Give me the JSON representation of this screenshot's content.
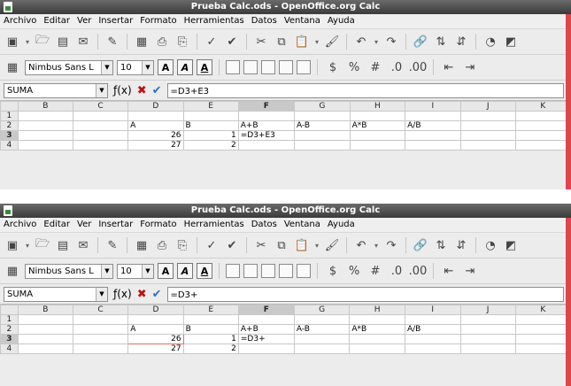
{
  "window_title": "Prueba Calc.ods - OpenOffice.org Calc",
  "menu": [
    "Archivo",
    "Editar",
    "Ver",
    "Insertar",
    "Formato",
    "Herramientas",
    "Datos",
    "Ventana",
    "Ayuda"
  ],
  "font_name": "Nimbus Sans L",
  "font_size": "10",
  "name_box": "SUMA",
  "accent_color": "#e0444f",
  "columns": [
    "",
    "B",
    "C",
    "D",
    "E",
    "F",
    "G",
    "H",
    "I",
    "J",
    "K"
  ],
  "shots": [
    {
      "formula": "=D3+E3",
      "rows": [
        {
          "num": "1",
          "cells": [
            "",
            "",
            "",
            "",
            "",
            "",
            "",
            "",
            "",
            ""
          ]
        },
        {
          "num": "2",
          "cells": [
            "",
            "",
            "A",
            "B",
            "A+B",
            "A-B",
            "A*B",
            "A/B",
            "",
            ""
          ]
        },
        {
          "num": "3",
          "cells": [
            "",
            "",
            "26",
            "1",
            "=D3+E3",
            "",
            "",
            "",
            "",
            ""
          ]
        },
        {
          "num": "4",
          "cells": [
            "",
            "",
            "27",
            "2",
            "",
            "",
            "",
            "",
            "",
            ""
          ]
        }
      ]
    },
    {
      "formula": "=D3+",
      "rows": [
        {
          "num": "1",
          "cells": [
            "",
            "",
            "",
            "",
            "",
            "",
            "",
            "",
            "",
            ""
          ]
        },
        {
          "num": "2",
          "cells": [
            "",
            "",
            "A",
            "B",
            "A+B",
            "A-B",
            "A*B",
            "A/B",
            "",
            ""
          ]
        },
        {
          "num": "3",
          "cells": [
            "",
            "",
            "26",
            "1",
            "=D3+",
            "",
            "",
            "",
            "",
            ""
          ]
        },
        {
          "num": "4",
          "cells": [
            "",
            "",
            "27",
            "2",
            "",
            "",
            "",
            "",
            "",
            ""
          ]
        }
      ]
    }
  ]
}
